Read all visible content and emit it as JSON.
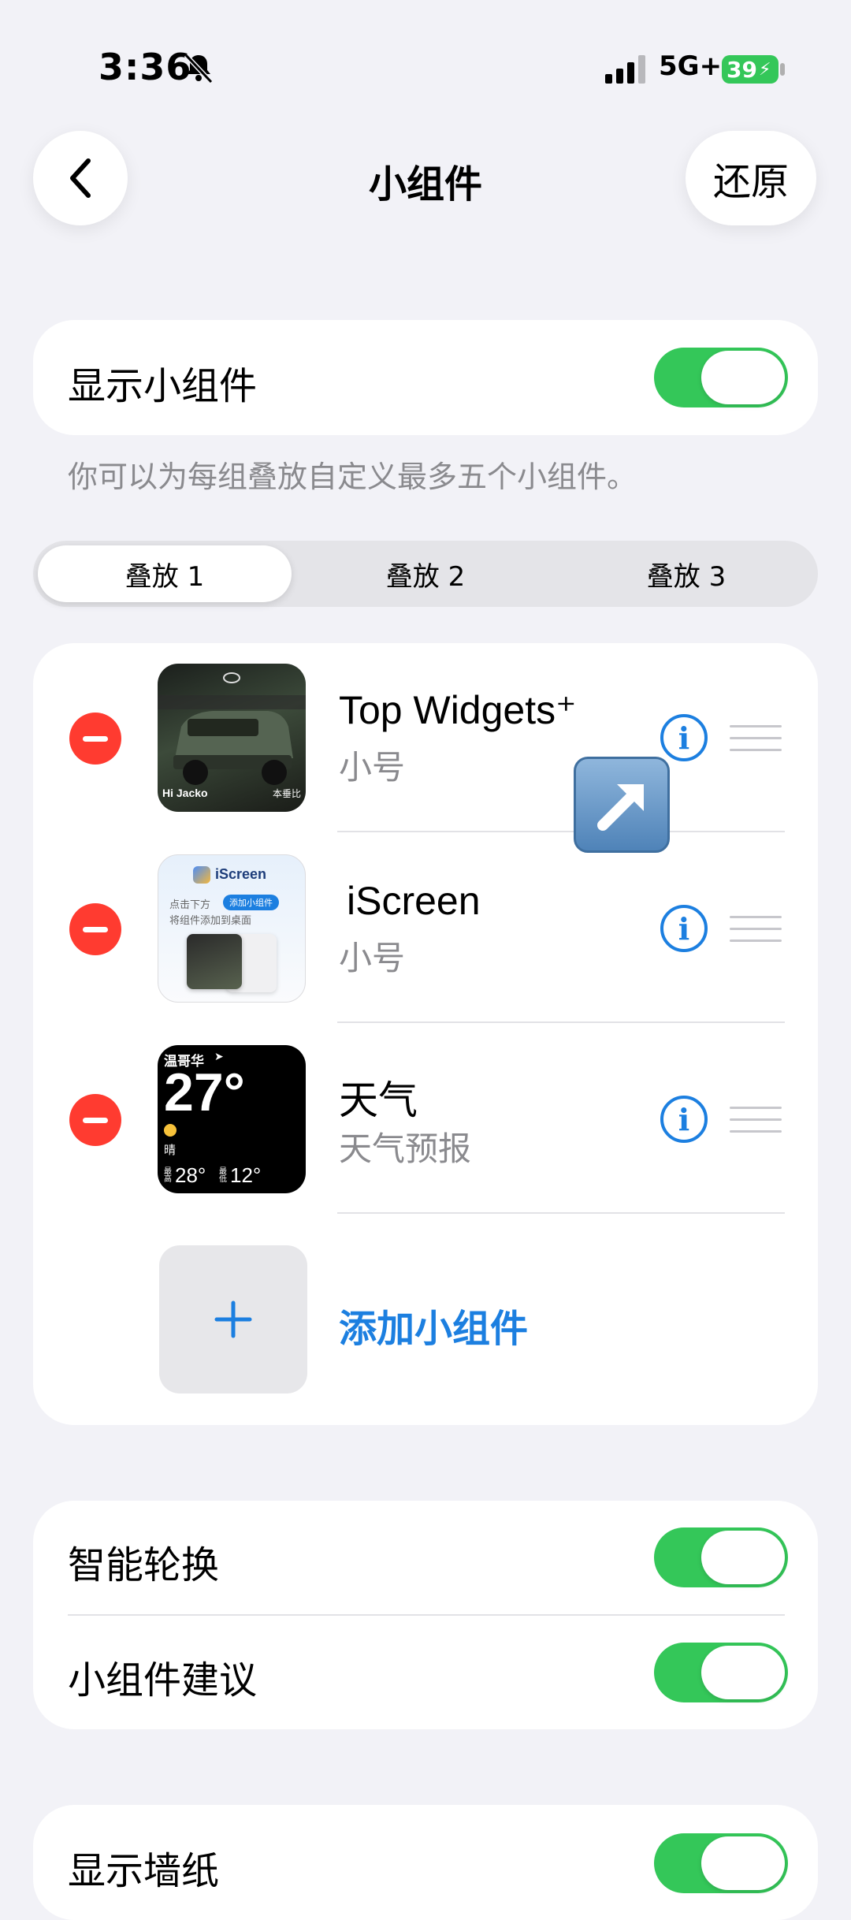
{
  "status_bar": {
    "time": "3:36",
    "network": "5G+",
    "battery": "39"
  },
  "nav": {
    "title": "小组件",
    "reset_label": "还原"
  },
  "show_widgets": {
    "label": "显示小组件",
    "enabled": true,
    "hint": "你可以为每组叠放自定义最多五个小组件。"
  },
  "stacks": {
    "tabs": [
      "叠放 1",
      "叠放 2",
      "叠放 3"
    ],
    "selected": "叠放 1"
  },
  "widgets": [
    {
      "title": "Top Widgets⁺",
      "subtitle": "小号",
      "thumb_top_left": "Hi  Jacko",
      "thumb_top_right": "本垂比"
    },
    {
      "title": "iScreen",
      "subtitle": "小号",
      "thumb_app": "iScreen",
      "thumb_line1": "点击下方",
      "thumb_pill": "添加小组件",
      "thumb_line2": "将组件添加到桌面"
    },
    {
      "title": "天气",
      "subtitle": "天气预报",
      "thumb_city": "温哥华",
      "thumb_temp": "27°",
      "thumb_cond": "晴",
      "thumb_high_label": "最高",
      "thumb_high": "28°",
      "thumb_low_label": "最低",
      "thumb_low": "12°"
    }
  ],
  "add_widget_label": "添加小组件",
  "settings": {
    "smart_rotate": {
      "label": "智能轮换",
      "enabled": true
    },
    "widget_suggestions": {
      "label": "小组件建议",
      "enabled": true
    },
    "next_partial": {
      "label": "显示墙纸",
      "enabled": true
    }
  },
  "colors": {
    "accent": "#1c7fe0",
    "toggle_on": "#34c759",
    "destructive": "#ff3b30",
    "background": "#f2f2f7"
  }
}
